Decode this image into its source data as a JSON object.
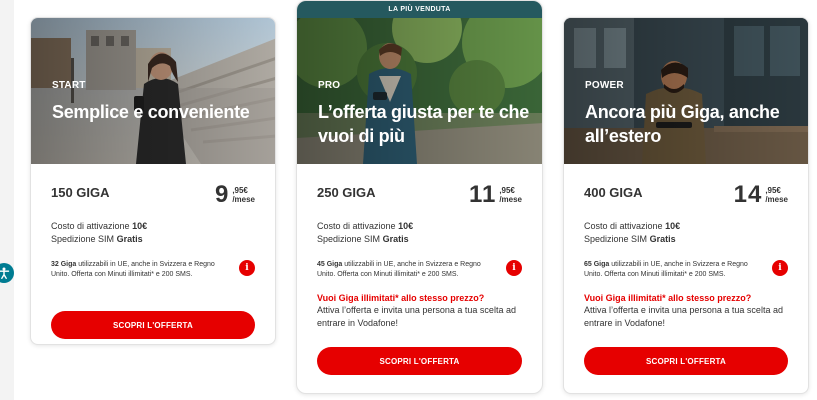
{
  "accessibility": {
    "icon": "accessibility-icon"
  },
  "offers": [
    {
      "tag": "START",
      "headline": "Semplice e conveniente",
      "giga": "150 GIGA",
      "price_euros": "9",
      "price_cents": ",95€",
      "price_period": "/mese",
      "activation_label": "Costo di attivazione",
      "activation_value": "10€",
      "shipping_label": "Spedizione SIM",
      "shipping_value": "Gratis",
      "info_bold": "32 Giga",
      "info_text": " utilizzabili in UE, anche in Svizzera e Regno Unito. Offerta con Minuti illimitati* e 200 SMS.",
      "cta": "SCOPRI L'OFFERTA"
    },
    {
      "ribbon": "LA PIÙ VENDUTA",
      "tag": "PRO",
      "headline": "L’offerta giusta per te che vuoi di più",
      "giga": "250 GIGA",
      "price_euros": "11",
      "price_cents": ",95€",
      "price_period": "/mese",
      "activation_label": "Costo di attivazione",
      "activation_value": "10€",
      "shipping_label": "Spedizione SIM",
      "shipping_value": "Gratis",
      "info_bold": "45 Giga",
      "info_text": " utilizzabili in UE, anche in Svizzera e Regno Unito. Offerta con Minuti illimitati* e 200 SMS.",
      "promo_title": "Vuoi Giga illimitati* allo stesso prezzo?",
      "promo_text": "Attiva l’offerta e invita una persona a tua scelta ad entrare in Vodafone!",
      "cta": "SCOPRI L'OFFERTA"
    },
    {
      "tag": "POWER",
      "headline": "Ancora più Giga, anche all’estero",
      "giga": "400 GIGA",
      "price_euros": "14",
      "price_cents": ",95€",
      "price_period": "/mese",
      "activation_label": "Costo di attivazione",
      "activation_value": "10€",
      "shipping_label": "Spedizione SIM",
      "shipping_value": "Gratis",
      "info_bold": "65 Giga",
      "info_text": " utilizzabili in UE, anche in Svizzera e Regno Unito. Offerta con Minuti illimitati* e 200 SMS.",
      "promo_title": "Vuoi Giga illimitati* allo stesso prezzo?",
      "promo_text": "Attiva l’offerta e invita una persona a tua scelta ad entrare in Vodafone!",
      "cta": "SCOPRI L'OFFERTA"
    }
  ],
  "colors": {
    "brand_red": "#e60000",
    "ribbon_teal": "#25595f",
    "text": "#333333"
  },
  "icons": {
    "info": "info-icon"
  }
}
